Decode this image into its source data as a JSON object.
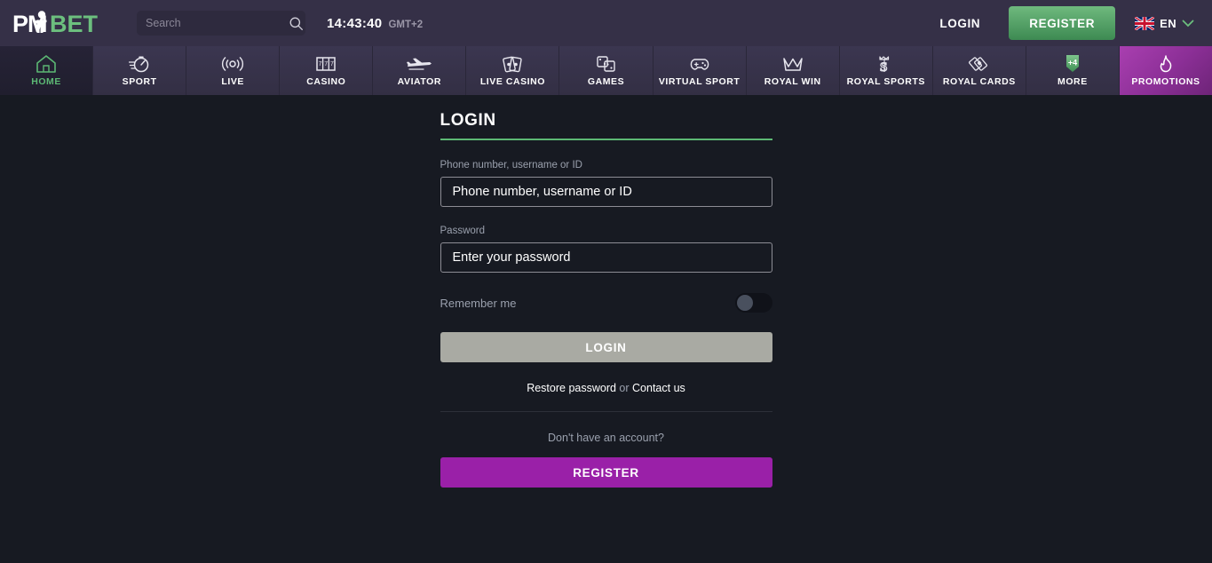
{
  "header": {
    "logo": {
      "name": "pmbet-logo",
      "text_white": "PM",
      "text_green": "BET"
    },
    "search": {
      "placeholder": "Search",
      "value": "",
      "icon": "search-icon"
    },
    "clock": {
      "time": "14:43:40",
      "timezone": "GMT+2"
    },
    "login_label": "LOGIN",
    "register_label": "REGISTER",
    "language": {
      "code": "EN",
      "flag": "uk-flag-icon",
      "chevron": "chevron-down-icon"
    }
  },
  "nav": {
    "items": [
      {
        "label": "HOME",
        "icon": "home-icon",
        "active": true
      },
      {
        "label": "SPORT",
        "icon": "stopwatch-icon",
        "active": false
      },
      {
        "label": "LIVE",
        "icon": "live-broadcast-icon",
        "active": false
      },
      {
        "label": "CASINO",
        "icon": "slot-machine-icon",
        "active": false
      },
      {
        "label": "AVIATOR",
        "icon": "airplane-icon",
        "active": false
      },
      {
        "label": "LIVE CASINO",
        "icon": "playing-cards-icon",
        "active": false
      },
      {
        "label": "GAMES",
        "icon": "dice-icon",
        "active": false
      },
      {
        "label": "VIRTUAL SPORT",
        "icon": "gamepad-icon",
        "active": false
      },
      {
        "label": "ROYAL WIN",
        "icon": "crown-icon",
        "active": false
      },
      {
        "label": "ROYAL SPORTS",
        "icon": "royal-s-icon",
        "active": false
      },
      {
        "label": "ROYAL CARDS",
        "icon": "royal-cards-icon",
        "active": false
      },
      {
        "label": "MORE",
        "icon": "more-badge-icon",
        "badge": "+4",
        "active": false
      },
      {
        "label": "PROMOTIONS",
        "icon": "flame-icon",
        "active": false,
        "highlight": true
      }
    ]
  },
  "login_form": {
    "title": "LOGIN",
    "username": {
      "label": "Phone number, username or ID",
      "placeholder": "Phone number, username or ID",
      "value": ""
    },
    "password": {
      "label": "Password",
      "placeholder": "Enter your password",
      "value": ""
    },
    "remember": {
      "label": "Remember me",
      "checked": false
    },
    "submit_label": "LOGIN",
    "restore_label": "Restore password",
    "or_label": " or ",
    "contact_label": "Contact us",
    "no_account_text": "Don't have an account?",
    "register_label": "REGISTER"
  },
  "colors": {
    "header_bg": "#353047",
    "nav_bg": "#373249",
    "page_bg": "#171a22",
    "accent_green": "#5cb874",
    "accent_purple": "#9a20a8",
    "promo_purple": "#8b2f96",
    "disabled_grey": "#a9aaa3"
  }
}
